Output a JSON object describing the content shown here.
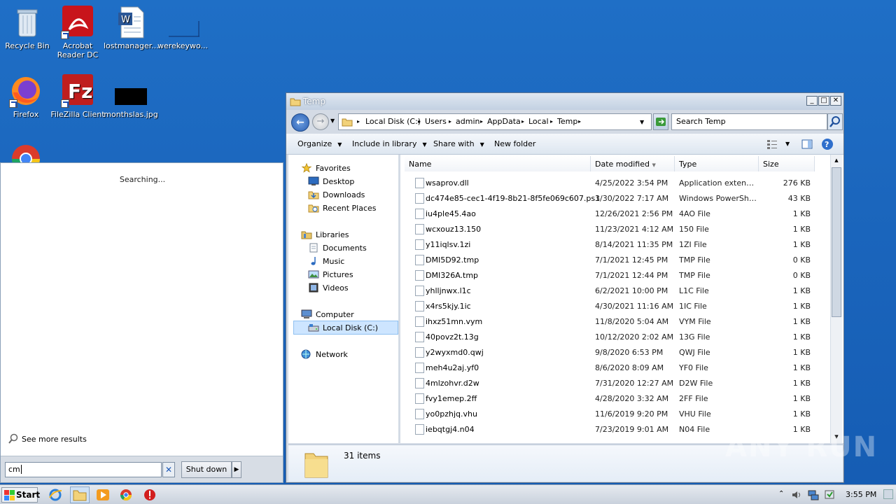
{
  "desktop": {
    "icons": [
      {
        "label": "Recycle Bin",
        "icon": "recycle-bin-icon"
      },
      {
        "label": "Acrobat Reader DC",
        "icon": "acrobat-icon"
      },
      {
        "label": "lostmanager...",
        "icon": "word-doc-icon"
      },
      {
        "label": "werekeywo...",
        "icon": "blank-file-icon"
      },
      {
        "label": "Firefox",
        "icon": "firefox-icon"
      },
      {
        "label": "FileZilla Client",
        "icon": "filezilla-icon"
      },
      {
        "label": "monthslas.jpg",
        "icon": "image-thumbnail-icon"
      }
    ]
  },
  "startmenu": {
    "status": "Searching...",
    "see_more": "See more results",
    "search_value": "cm",
    "shutdown_label": "Shut down"
  },
  "explorer": {
    "title": "Temp",
    "breadcrumbs": [
      "Local Disk (C:)",
      "Users",
      "admin",
      "AppData",
      "Local",
      "Temp"
    ],
    "search_placeholder": "Search Temp",
    "toolbar": {
      "organize": "Organize",
      "include": "Include in library",
      "share": "Share with",
      "new_folder": "New folder"
    },
    "nav": {
      "favorites": "Favorites",
      "desktop": "Desktop",
      "downloads": "Downloads",
      "recent": "Recent Places",
      "libraries": "Libraries",
      "documents": "Documents",
      "music": "Music",
      "pictures": "Pictures",
      "videos": "Videos",
      "computer": "Computer",
      "localdisk": "Local Disk (C:)",
      "network": "Network"
    },
    "columns": {
      "name": "Name",
      "date": "Date modified",
      "type": "Type",
      "size": "Size"
    },
    "files": [
      {
        "name": "wsaprov.dll",
        "date": "4/25/2022 3:54 PM",
        "type": "Application extension",
        "size": "276 KB"
      },
      {
        "name": "dc474e85-cec1-4f19-8b21-8f5fe069c607.ps1",
        "date": "3/30/2022 7:17 AM",
        "type": "Windows PowerShel...",
        "size": "43 KB"
      },
      {
        "name": "iu4ple45.4ao",
        "date": "12/26/2021 2:56 PM",
        "type": "4AO File",
        "size": "1 KB"
      },
      {
        "name": "wcxouz13.150",
        "date": "11/23/2021 4:12 AM",
        "type": "150 File",
        "size": "1 KB"
      },
      {
        "name": "y11iqlsv.1zi",
        "date": "8/14/2021 11:35 PM",
        "type": "1ZI File",
        "size": "1 KB"
      },
      {
        "name": "DMI5D92.tmp",
        "date": "7/1/2021 12:45 PM",
        "type": "TMP File",
        "size": "0 KB"
      },
      {
        "name": "DMI326A.tmp",
        "date": "7/1/2021 12:44 PM",
        "type": "TMP File",
        "size": "0 KB"
      },
      {
        "name": "yhlljnwx.l1c",
        "date": "6/2/2021 10:00 PM",
        "type": "L1C File",
        "size": "1 KB"
      },
      {
        "name": "x4rs5kjy.1ic",
        "date": "4/30/2021 11:16 AM",
        "type": "1IC File",
        "size": "1 KB"
      },
      {
        "name": "ihxz51mn.vym",
        "date": "11/8/2020 5:04 AM",
        "type": "VYM File",
        "size": "1 KB"
      },
      {
        "name": "40povz2t.13g",
        "date": "10/12/2020 2:02 AM",
        "type": "13G File",
        "size": "1 KB"
      },
      {
        "name": "y2wyxmd0.qwj",
        "date": "9/8/2020 6:53 PM",
        "type": "QWJ File",
        "size": "1 KB"
      },
      {
        "name": "meh4u2aj.yf0",
        "date": "8/6/2020 8:09 AM",
        "type": "YF0 File",
        "size": "1 KB"
      },
      {
        "name": "4mlzohvr.d2w",
        "date": "7/31/2020 12:27 AM",
        "type": "D2W File",
        "size": "1 KB"
      },
      {
        "name": "fvy1emep.2ff",
        "date": "4/28/2020 3:32 AM",
        "type": "2FF File",
        "size": "1 KB"
      },
      {
        "name": "yo0pzhjq.vhu",
        "date": "11/6/2019 9:20 PM",
        "type": "VHU File",
        "size": "1 KB"
      },
      {
        "name": "iebqtgj4.n04",
        "date": "7/23/2019 9:01 AM",
        "type": "N04 File",
        "size": "1 KB"
      }
    ],
    "item_count": "31 items"
  },
  "taskbar": {
    "start_label": "Start",
    "clock": "3:55 PM"
  },
  "watermark": "ANY RUN",
  "colors": {
    "desktop": "#1b66bd",
    "selection": "#cde5ff"
  }
}
